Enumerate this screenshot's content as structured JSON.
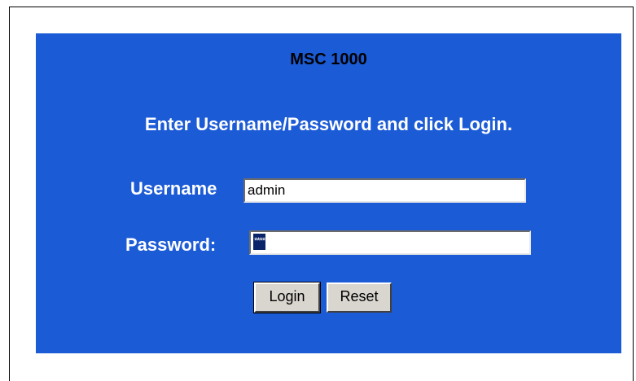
{
  "panel": {
    "title": "MSC 1000",
    "instruction": "Enter Username/Password and click Login.",
    "background_color": "#1c5bd6"
  },
  "form": {
    "username_label": "Username",
    "username_value": "admin",
    "password_label": "Password:",
    "password_mask": "****"
  },
  "buttons": {
    "login_label": "Login",
    "reset_label": "Reset"
  }
}
